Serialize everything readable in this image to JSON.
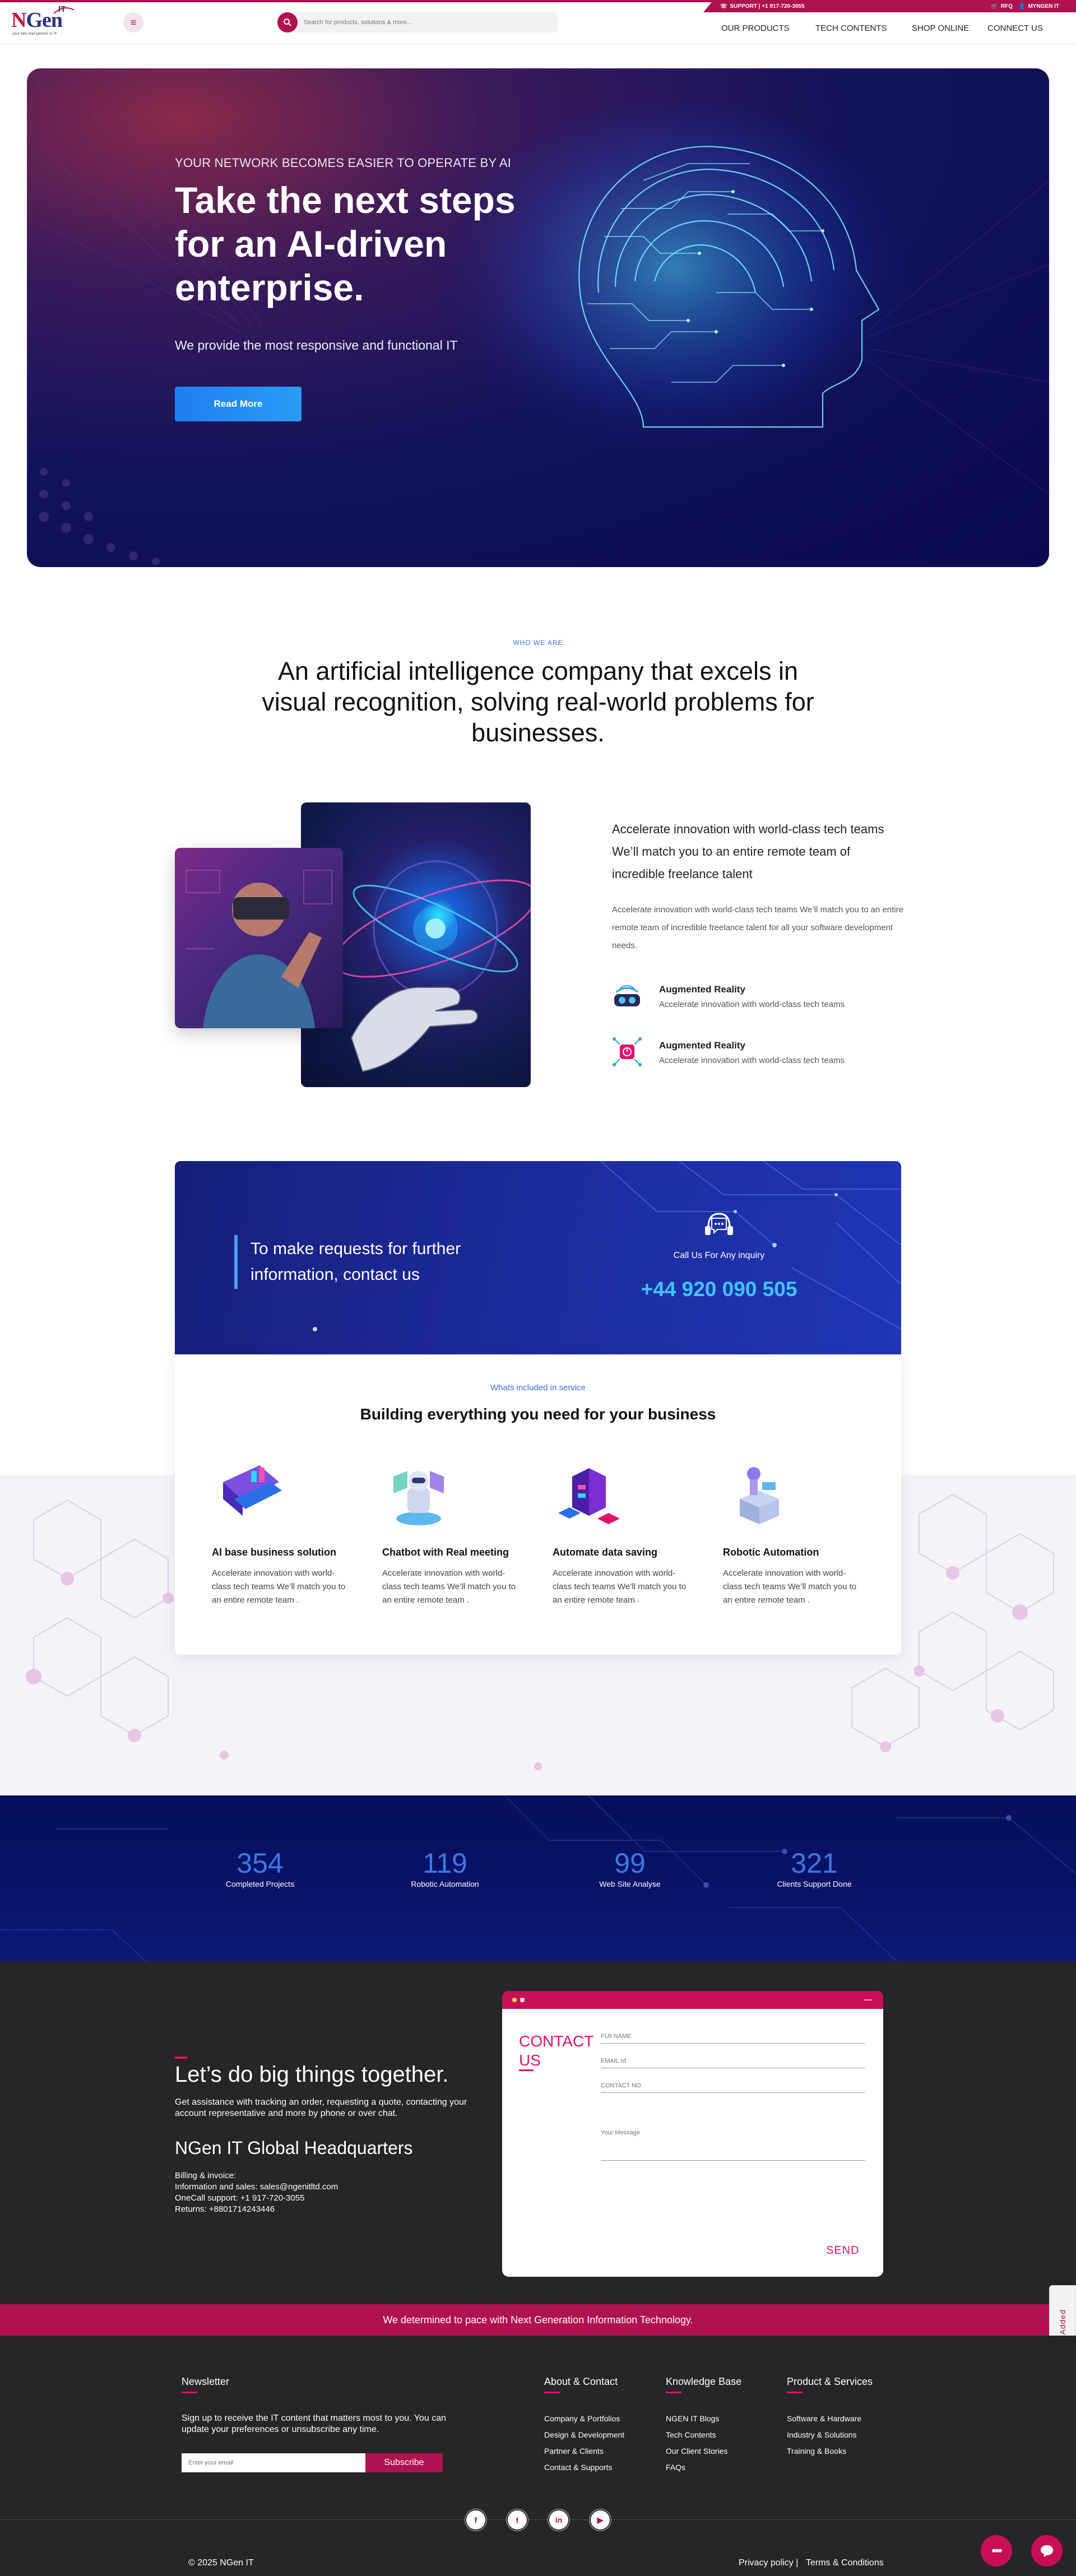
{
  "colors": {
    "brand": "#b0124f",
    "accent_blue": "#2a8af2",
    "navy": "#0b0a52",
    "dark": "#262527"
  },
  "utility_bar": {
    "support": "SUPPORT | +1 917-720-3055",
    "rfq": "RFQ",
    "account": "MYNGEN IT"
  },
  "header": {
    "logo": {
      "n": "N",
      "gen": "Gen",
      "it": "IT",
      "tagline": "your key and partner in IT"
    },
    "search_placeholder": "Search for products, solutions & more...",
    "nav": [
      "OUR PRODUCTS",
      "TECH CONTENTS",
      "SHOP ONLINE",
      "CONNECT US"
    ]
  },
  "hero": {
    "subtitle": "YOUR NETWORK BECOMES EASIER TO OPERATE BY AI",
    "title": "Take the next steps\nfor an AI-driven\nenterprise.",
    "description": "We provide the most responsive and functional IT",
    "cta": "Read More"
  },
  "about": {
    "eyebrow": "WHO WE ARE",
    "heading": "An artificial intelligence company that excels in\nvisual recognition, solving real-world problems for\nbusinesses.",
    "lead": "Accelerate innovation with world-class tech teams We’ll match you to an entire remote team of incredible freelance talent",
    "body": "Accelerate innovation with world-class tech teams We’ll match you to an entire remote team of incredible freelance talent for all your software development needs.",
    "features": [
      {
        "title": "Augmented Reality",
        "desc": "Accelerate innovation with world-class tech teams",
        "icon": "vr-headset-icon"
      },
      {
        "title": "Augmented Reality",
        "desc": "Accelerate innovation with world-class tech teams",
        "icon": "power-network-icon"
      }
    ]
  },
  "contact_banner": {
    "text": "To make requests for further\ninformation, contact us",
    "call_label": "Call Us For Any inquiry",
    "phone": "+44 920 090 505"
  },
  "services": {
    "eyebrow": "Whats included in service",
    "heading": "Building everything you need for your business",
    "items": [
      {
        "title": "AI base business solution",
        "desc": "Accelerate innovation with world-class tech teams We’ll match you to an entire remote team ."
      },
      {
        "title": "Chatbot with Real meeting",
        "desc": "Accelerate innovation with world-class tech teams We’ll match you to an entire remote team ."
      },
      {
        "title": "Automate data saving",
        "desc": "Accelerate innovation with world-class tech teams We’ll match you to an entire remote team ."
      },
      {
        "title": "Robotic Automation",
        "desc": "Accelerate innovation with world-class tech teams We’ll match you to an entire remote team ."
      }
    ]
  },
  "stats": [
    {
      "value": "354",
      "label": "Completed Projects"
    },
    {
      "value": "119",
      "label": "Robotic Automation"
    },
    {
      "value": "99",
      "label": "Web Site Analyse"
    },
    {
      "value": "321",
      "label": "Clients Support Done"
    }
  ],
  "contact": {
    "title": "Let’s do big things together.",
    "desc": "Get assistance with tracking an order, requesting a quote, contacting your account representative and more by phone or over chat.",
    "hq": "NGen IT Global Headquarters",
    "lines": [
      "Billing & invoice:",
      "Information and sales: sales@ngenitltd.com",
      "OneCall support: +1 917-720-3055",
      "Returns: +8801714243446"
    ],
    "form": {
      "heading": "CONTACT US",
      "name_placeholder": "FUll NAME",
      "email_placeholder": "EMAIL Id",
      "phone_placeholder": "CONTACT NO",
      "message_placeholder": "Your Message",
      "send": "SEND"
    }
  },
  "band": "We determined to pace with Next Generation Information Technology.",
  "rfq_tab": "RFQ Added",
  "footer": {
    "newsletter": {
      "title": "Newsletter",
      "text": "Sign up to receive the IT content that matters most to you. You can update your preferences or unsubscribe any time.",
      "placeholder": "Enter your email",
      "button": "Subscribe"
    },
    "columns": [
      {
        "title": "About & Contact",
        "links": [
          "Company & Portfolios",
          "Design & Development",
          "Partner & Clients",
          "Contact & Supports"
        ]
      },
      {
        "title": "Knowledge Base",
        "links": [
          "NGEN IT Blogs",
          "Tech Contents",
          "Our Client Stories",
          "FAQs"
        ]
      },
      {
        "title": "Product & Services",
        "links": [
          "Software & Hardware",
          "Industry & Solutions",
          "Training & Books"
        ]
      }
    ],
    "social": [
      {
        "name": "facebook",
        "glyph": "f"
      },
      {
        "name": "twitter",
        "glyph": "t"
      },
      {
        "name": "linkedin",
        "glyph": "in"
      },
      {
        "name": "youtube",
        "glyph": "▶"
      }
    ],
    "copyright": "© 2025 NGen IT",
    "privacy": "Privacy policy |",
    "terms": "Terms & Conditions"
  }
}
